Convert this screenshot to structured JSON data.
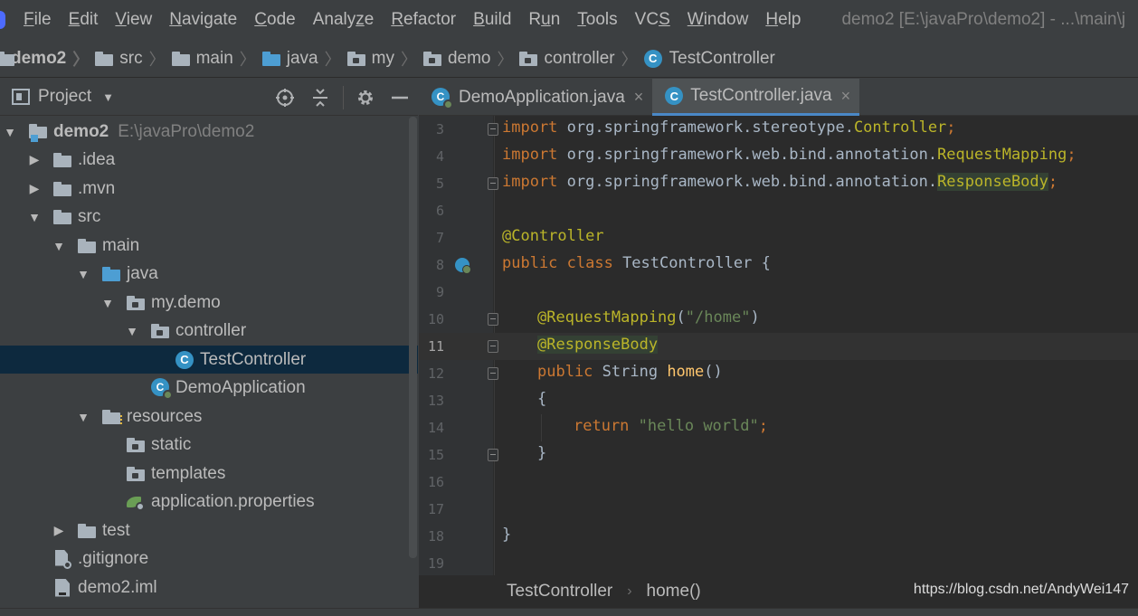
{
  "menubar": {
    "items": [
      {
        "pre": "",
        "mn": "F",
        "post": "ile"
      },
      {
        "pre": "",
        "mn": "E",
        "post": "dit"
      },
      {
        "pre": "",
        "mn": "V",
        "post": "iew"
      },
      {
        "pre": "",
        "mn": "N",
        "post": "avigate"
      },
      {
        "pre": "",
        "mn": "C",
        "post": "ode"
      },
      {
        "pre": "Analy",
        "mn": "z",
        "post": "e"
      },
      {
        "pre": "",
        "mn": "R",
        "post": "efactor"
      },
      {
        "pre": "",
        "mn": "B",
        "post": "uild"
      },
      {
        "pre": "R",
        "mn": "u",
        "post": "n"
      },
      {
        "pre": "",
        "mn": "T",
        "post": "ools"
      },
      {
        "pre": "VC",
        "mn": "S",
        "post": ""
      },
      {
        "pre": "",
        "mn": "W",
        "post": "indow"
      },
      {
        "pre": "",
        "mn": "H",
        "post": "elp"
      }
    ],
    "window_title": "demo2 [E:\\javaPro\\demo2] - ...\\main\\j"
  },
  "breadcrumb": [
    "demo2",
    "src",
    "main",
    "java",
    "my",
    "demo",
    "controller",
    "TestController"
  ],
  "project_panel": {
    "title": "Project",
    "tree": {
      "root_name": "demo2",
      "root_path": "E:\\javaPro\\demo2",
      "idea": ".idea",
      "mvn": ".mvn",
      "src": "src",
      "main": "main",
      "java": "java",
      "my_demo": "my.demo",
      "controller": "controller",
      "test_controller": "TestController",
      "demo_application": "DemoApplication",
      "resources": "resources",
      "static": "static",
      "templates": "templates",
      "app_props": "application.properties",
      "test": "test",
      "gitignore": ".gitignore",
      "iml": "demo2.iml"
    }
  },
  "editor": {
    "tabs": [
      {
        "label": "DemoApplication.java",
        "close": "×"
      },
      {
        "label": "TestController.java",
        "close": "×"
      }
    ],
    "line_numbers": [
      "3",
      "4",
      "5",
      "6",
      "7",
      "8",
      "9",
      "10",
      "11",
      "12",
      "13",
      "14",
      "15",
      "16",
      "17",
      "18",
      "19"
    ],
    "code": {
      "l3_kw": "import",
      "l3_pkg": " org.springframework.stereotype.",
      "l3_cls": "Controller",
      "l4_kw": "import",
      "l4_pkg": " org.springframework.web.bind.annotation.",
      "l4_cls": "RequestMapping",
      "l5_kw": "import",
      "l5_pkg": " org.springframework.web.bind.annotation.",
      "l5_cls": "ResponseBody",
      "semi": ";",
      "l7_ann": "@Controller",
      "l8_kw": "public class",
      "l8_rest": " TestController {",
      "l10_ann": "@RequestMapping",
      "l10_open": "(",
      "l10_str": "\"/home\"",
      "l10_close": ")",
      "l11_ann": "@ResponseBody",
      "l12_kw": "public",
      "l12_type": " String ",
      "l12_fn": "home",
      "l12_paren": "()",
      "l13": "{",
      "l14_kw": "return",
      "l14_str": "\"hello world\"",
      "l15": "}",
      "l18": "}"
    },
    "breadcrumb": [
      "TestController",
      "home()"
    ]
  },
  "watermark": "https://blog.csdn.net/AndyWei147"
}
